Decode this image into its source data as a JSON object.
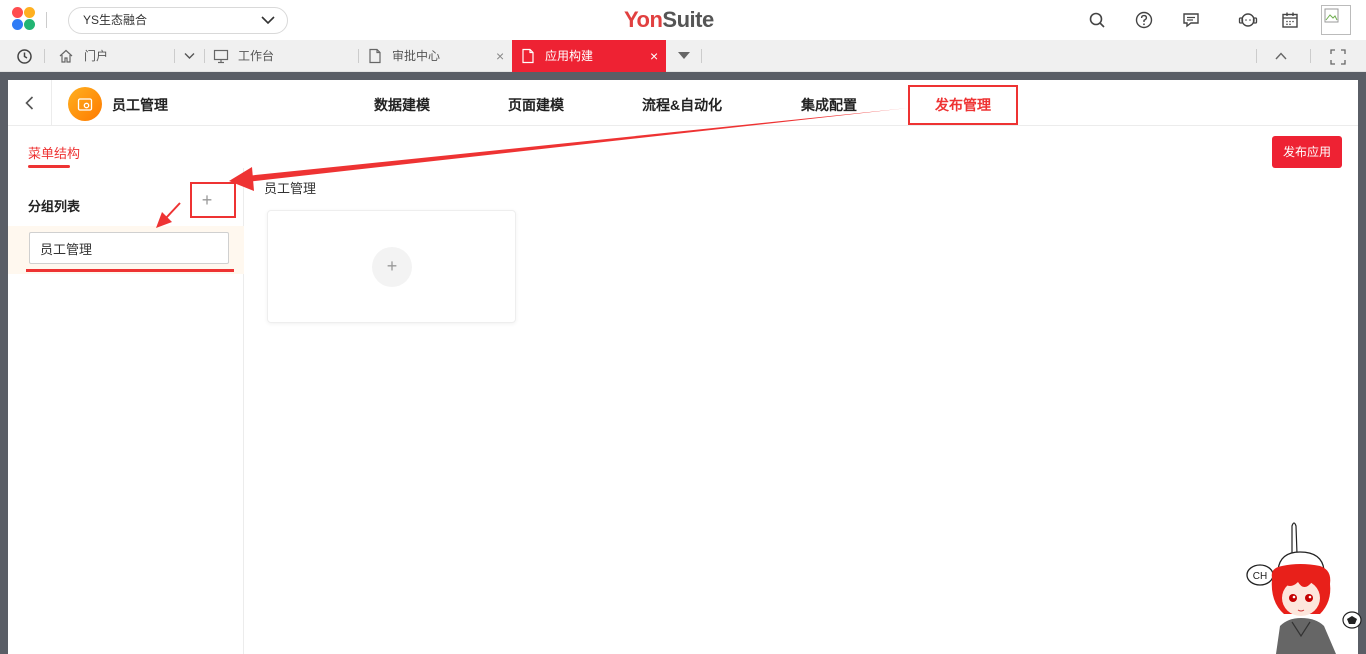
{
  "topbar": {
    "org_select": "YS生态融合",
    "brand_first": "Yon",
    "brand_second": "Suite",
    "icons": [
      "search-icon",
      "help-icon",
      "message-icon",
      "service-icon",
      "calendar-icon",
      "avatar-image"
    ]
  },
  "tabs": [
    {
      "label": "门户",
      "icon": "home-icon"
    },
    {
      "label": "工作台",
      "icon": "monitor-icon"
    },
    {
      "label": "审批中心",
      "icon": "document-icon"
    },
    {
      "label": "应用构建",
      "icon": "document-icon",
      "active": true
    }
  ],
  "app": {
    "name": "员工管理",
    "nav": [
      "数据建模",
      "页面建模",
      "流程&自动化",
      "集成配置",
      "发布管理"
    ],
    "active_nav": "发布管理"
  },
  "page": {
    "sub_tab": "菜单结构",
    "publish_button": "发布应用",
    "group_list_title": "分组列表",
    "add_symbol": "+",
    "group_input_value": "员工管理",
    "content_title": "员工管理",
    "card_add_symbol": "+"
  },
  "mascot_text": "CH",
  "colors": {
    "accent": "#ee2233",
    "highlight_red": "#e33333",
    "brand_red": "#e14040",
    "selected_row_bg": "#fff8ef"
  }
}
